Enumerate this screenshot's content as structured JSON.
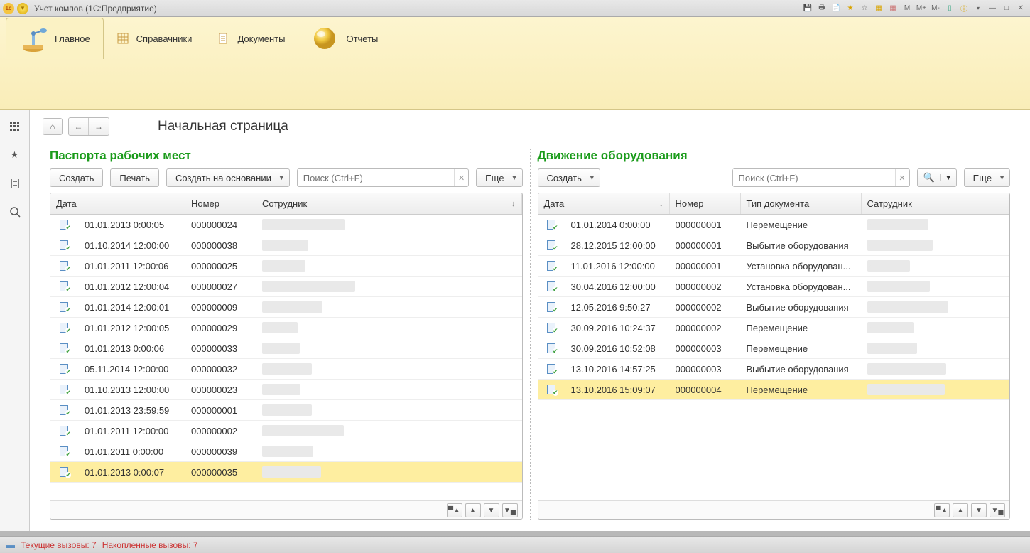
{
  "title": "Учет компов  (1С:Предприятие)",
  "ribbon": {
    "tabs": [
      {
        "label": "Главное"
      },
      {
        "label": "Справачники"
      },
      {
        "label": "Документы"
      },
      {
        "label": "Отчеты"
      }
    ]
  },
  "page_title": "Начальная страница",
  "panel1": {
    "title": "Паспорта рабочих мест",
    "btn_create": "Создать",
    "btn_print": "Печать",
    "btn_base": "Создать на основании",
    "search_ph": "Поиск (Ctrl+F)",
    "btn_more": "Еще",
    "cols": {
      "date": "Дата",
      "num": "Номер",
      "emp": "Сотрудник"
    },
    "rows": [
      {
        "date": "01.01.2013 0:00:05",
        "num": "000000024"
      },
      {
        "date": "01.10.2014 12:00:00",
        "num": "000000038"
      },
      {
        "date": "01.01.2011 12:00:06",
        "num": "000000025"
      },
      {
        "date": "01.01.2012 12:00:04",
        "num": "000000027"
      },
      {
        "date": "01.01.2014 12:00:01",
        "num": "000000009"
      },
      {
        "date": "01.01.2012 12:00:05",
        "num": "000000029"
      },
      {
        "date": "01.01.2013 0:00:06",
        "num": "000000033"
      },
      {
        "date": "05.11.2014 12:00:00",
        "num": "000000032"
      },
      {
        "date": "01.10.2013 12:00:00",
        "num": "000000023"
      },
      {
        "date": "01.01.2013 23:59:59",
        "num": "000000001"
      },
      {
        "date": "01.01.2011 12:00:00",
        "num": "000000002"
      },
      {
        "date": "01.01.2011 0:00:00",
        "num": "000000039"
      },
      {
        "date": "01.01.2013 0:00:07",
        "num": "000000035"
      }
    ],
    "sel": 12
  },
  "panel2": {
    "title": "Движение оборудования",
    "btn_create": "Создать",
    "search_ph": "Поиск (Ctrl+F)",
    "btn_more": "Еще",
    "cols": {
      "date": "Дата",
      "num": "Номер",
      "type": "Тип документа",
      "emp": "Сатрудник"
    },
    "rows": [
      {
        "date": "01.01.2014 0:00:00",
        "num": "000000001",
        "type": "Перемещение"
      },
      {
        "date": "28.12.2015 12:00:00",
        "num": "000000001",
        "type": "Выбытие оборудования"
      },
      {
        "date": "11.01.2016 12:00:00",
        "num": "000000001",
        "type": "Установка оборудован..."
      },
      {
        "date": "30.04.2016 12:00:00",
        "num": "000000002",
        "type": "Установка оборудован..."
      },
      {
        "date": "12.05.2016 9:50:27",
        "num": "000000002",
        "type": "Выбытие оборудования"
      },
      {
        "date": "30.09.2016 10:24:37",
        "num": "000000002",
        "type": "Перемещение"
      },
      {
        "date": "30.09.2016 10:52:08",
        "num": "000000003",
        "type": "Перемещение"
      },
      {
        "date": "13.10.2016 14:57:25",
        "num": "000000003",
        "type": "Выбытие оборудования"
      },
      {
        "date": "13.10.2016 15:09:07",
        "num": "000000004",
        "type": "Перемещение"
      }
    ],
    "sel": 8
  },
  "status": {
    "a": "Текущие вызовы: 7",
    "b": "Накопленные вызовы: 7"
  },
  "toolbar_m": [
    "M",
    "M+",
    "M-"
  ]
}
